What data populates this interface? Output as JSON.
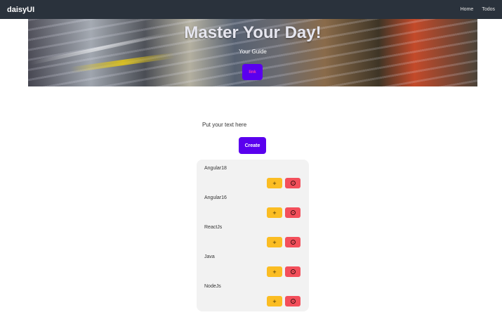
{
  "navbar": {
    "brand": "daisyUI",
    "links": [
      "Home",
      "Todos"
    ]
  },
  "hero": {
    "title": "Master Your Day!",
    "subtitle": "Your Guide",
    "button_label": "link"
  },
  "form": {
    "input_placeholder": "Put your text here",
    "create_label": "Create"
  },
  "todos": [
    {
      "label": "Angular18",
      "add_icon": "plus-icon",
      "delete_icon": "circle-x-icon"
    },
    {
      "label": "Angular16",
      "add_icon": "plus-icon",
      "delete_icon": "circle-x-icon"
    },
    {
      "label": "ReactJs",
      "add_icon": "plus-icon",
      "delete_icon": "circle-x-icon"
    },
    {
      "label": "Java",
      "add_icon": "plus-icon",
      "delete_icon": "circle-x-icon"
    },
    {
      "label": "NodeJs",
      "add_icon": "plus-icon",
      "delete_icon": "circle-x-icon"
    }
  ],
  "colors": {
    "navbar": "#2a323c",
    "primary": "#5a00ee",
    "warning": "#fbbd23",
    "error": "#f34f5b",
    "card": "#f2f2f2"
  }
}
